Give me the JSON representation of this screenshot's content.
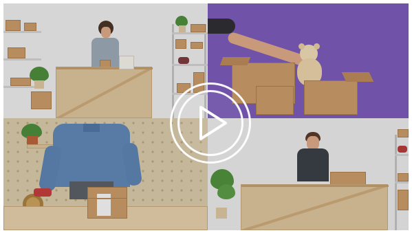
{
  "video": {
    "play_button_icon": "play-icon",
    "accent_color": "#ffffff",
    "tiles": [
      {
        "scene": "woman-packing-warehouse"
      },
      {
        "scene": "hand-holding-teddy-bear-purple"
      },
      {
        "scene": "man-taping-box"
      },
      {
        "scene": "man-at-wooden-counter"
      }
    ]
  }
}
